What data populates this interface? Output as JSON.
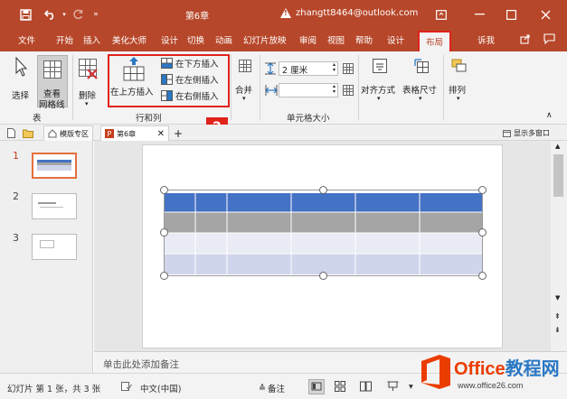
{
  "titlebar": {
    "doc_title": "第6章",
    "account_email": "zhangtt8464@outlook.com"
  },
  "tabs": [
    "文件",
    "开始",
    "插入",
    "美化大师",
    "设计",
    "切换",
    "动画",
    "幻灯片放映",
    "审阅",
    "视图",
    "帮助",
    "设计",
    "布局",
    "操作说明搜索"
  ],
  "tab_visible_search": "诉我",
  "ribbon": {
    "select_label": "选择",
    "gridlines_label_1": "查看",
    "gridlines_label_2": "网格线",
    "delete_label": "删除",
    "group_table_label": "表",
    "insert_above_label": "在上方插入",
    "insert_below_label": "在下方插入",
    "insert_left_label": "在左侧插入",
    "insert_right_label": "在右侧插入",
    "group_rows_cols_label": "行和列",
    "merge_label": "合并",
    "height_value": "2 厘米",
    "width_value": "",
    "group_cell_size_label": "单元格大小",
    "align_label": "对齐方式",
    "table_size_label": "表格尺寸",
    "arrange_label": "排列"
  },
  "doc_tabs": {
    "template_label": "模版专区",
    "chapter_label": "第6章",
    "display_multi_window": "显示多窗口"
  },
  "slides": [
    {
      "num": "1"
    },
    {
      "num": "2"
    },
    {
      "num": "3"
    }
  ],
  "notes_placeholder": "单击此处添加备注",
  "status": {
    "slide_info": "幻灯片 第 1 张，共 3 张",
    "language": "中文(中国)",
    "notes_button": "备注"
  },
  "badges": {
    "one": "1",
    "two": "2"
  },
  "watermark": {
    "brand_1": "Office",
    "brand_2": "教程网",
    "url": "www.office26.com"
  },
  "colors": {
    "accent": "#b7472a",
    "highlight_red": "#e0231b",
    "table_header": "#4472c4",
    "table_row_gray": "#a5a5a5",
    "table_row_light": "#e9ebf5",
    "table_row_blue": "#cfd5ea",
    "thumb_selected": "#e4703d"
  }
}
